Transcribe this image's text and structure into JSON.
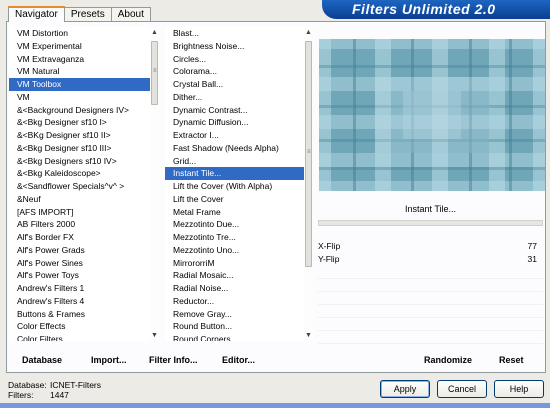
{
  "window": {
    "brand_title": "Filters Unlimited 2.0"
  },
  "tabs": [
    {
      "label": "Navigator",
      "active": true
    },
    {
      "label": "Presets",
      "active": false
    },
    {
      "label": "About",
      "active": false
    }
  ],
  "categories": {
    "selected": "VM Toolbox",
    "items": [
      "VM Distortion",
      "VM Experimental",
      "VM Extravaganza",
      "VM Natural",
      "VM Toolbox",
      "VM",
      "&<Background Designers IV>",
      "&<Bkg Designer sf10 I>",
      "&<BKg Designer sf10 II>",
      "&<Bkg Designer sf10 III>",
      "&<Bkg Designers sf10 IV>",
      "&<Bkg Kaleidoscope>",
      "&<Sandflower Specials^v^ >",
      "&Neuf",
      "[AFS IMPORT]",
      "AB Filters 2000",
      "Alf's Border FX",
      "Alf's Power Grads",
      "Alf's Power Sines",
      "Alf's Power Toys",
      "Andrew's Filters 1",
      "Andrew's Filters 4",
      "Buttons & Frames",
      "Color Effects",
      "Color Filters"
    ]
  },
  "filters": {
    "selected": "Instant Tile...",
    "items": [
      "Blast...",
      "Brightness Noise...",
      "Circles...",
      "Colorama...",
      "Crystal Ball...",
      "Dither...",
      "Dynamic Contrast...",
      "Dynamic Diffusion...",
      "Extractor I...",
      "Fast Shadow (Needs Alpha)",
      "Grid...",
      "Instant Tile...",
      "Lift the Cover (With Alpha)",
      "Lift the Cover",
      "Metal Frame",
      "Mezzotinto Due...",
      "Mezzotinto Tre...",
      "Mezzotinto Uno...",
      "MirrororriM",
      "Radial Mosaic...",
      "Radial Noise...",
      "Reductor...",
      "Remove Gray...",
      "Round Button...",
      "Round Corners"
    ]
  },
  "preview": {
    "filter_name": "Instant Tile...",
    "colors": {
      "base": "#6fa6b8",
      "light": "#b9dbe6",
      "dark": "#3f7d91"
    }
  },
  "params": [
    {
      "label": "X-Flip",
      "value": "77"
    },
    {
      "label": "Y-Flip",
      "value": "31"
    }
  ],
  "panel_buttons": {
    "database": "Database",
    "import": "Import...",
    "filter_info": "Filter Info...",
    "editor": "Editor...",
    "randomize": "Randomize",
    "reset": "Reset"
  },
  "footer": {
    "database_label": "Database:",
    "database_value": "ICNET-Filters",
    "filters_label": "Filters:",
    "filters_value": "1447"
  },
  "dialog_buttons": {
    "apply": "Apply",
    "cancel": "Cancel",
    "help": "Help"
  }
}
